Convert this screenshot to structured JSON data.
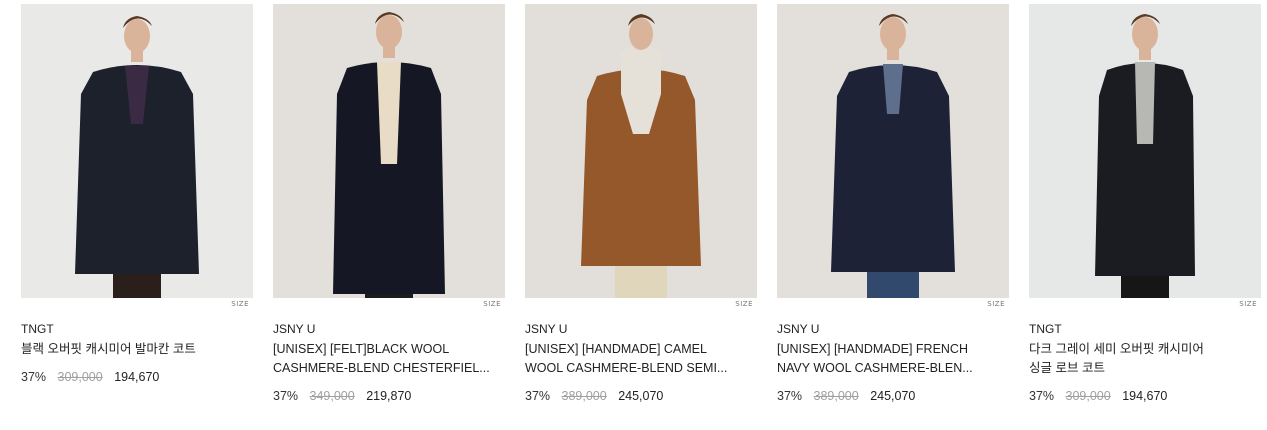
{
  "products": [
    {
      "brand": "TNGT",
      "name_line1": "블랙 오버핏 캐시미어 발마칸 코트",
      "name_line2": "",
      "discount": "37%",
      "original_price": "309,000",
      "price": "194,670",
      "size_tag": "SIZE",
      "colors": {
        "bg": "#e9e9e8",
        "coat": "#1c212c",
        "inner": "#3a2a44",
        "pants": "#2a1f1a"
      }
    },
    {
      "brand": "JSNY U",
      "name_line1": "[UNISEX] [FELT]BLACK WOOL",
      "name_line2": "CASHMERE-BLEND CHESTERFIEL...",
      "discount": "37%",
      "original_price": "349,000",
      "price": "219,870",
      "size_tag": "SIZE",
      "colors": {
        "bg": "#e3dfdb",
        "coat": "#151824",
        "inner": "#e8dcc6",
        "pants": "#1c1c1c"
      }
    },
    {
      "brand": "JSNY U",
      "name_line1": "[UNISEX] [HANDMADE] CAMEL",
      "name_line2": "WOOL CASHMERE-BLEND SEMI...",
      "discount": "37%",
      "original_price": "389,000",
      "price": "245,070",
      "size_tag": "SIZE",
      "colors": {
        "bg": "#e2dfda",
        "coat": "#94582a",
        "inner": "#e6e1d8",
        "pants": "#e0d6bc"
      }
    },
    {
      "brand": "JSNY U",
      "name_line1": "[UNISEX] [HANDMADE] FRENCH",
      "name_line2": "NAVY WOOL CASHMERE-BLEN...",
      "discount": "37%",
      "original_price": "389,000",
      "price": "245,070",
      "size_tag": "SIZE",
      "colors": {
        "bg": "#e3e0dc",
        "coat": "#1e2236",
        "inner": "#5d6f8c",
        "pants": "#32496e"
      }
    },
    {
      "brand": "TNGT",
      "name_line1": "다크 그레이 세미 오버핏 캐시미어",
      "name_line2": "싱글 로브 코트",
      "discount": "37%",
      "original_price": "309,000",
      "price": "194,670",
      "size_tag": "SIZE",
      "colors": {
        "bg": "#e6e7e7",
        "coat": "#1a1c22",
        "inner": "#b7b7b4",
        "pants": "#161616"
      }
    }
  ]
}
